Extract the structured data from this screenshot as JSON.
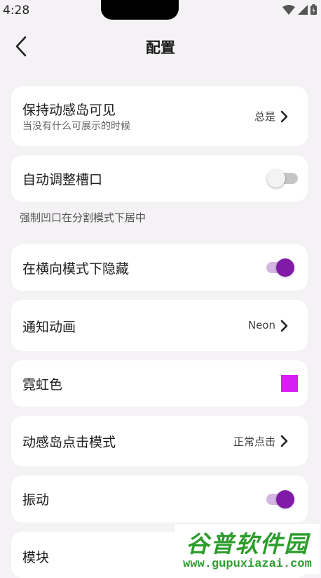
{
  "status_bar": {
    "time": "4:28"
  },
  "header": {
    "title": "配置"
  },
  "settings": {
    "keep_island": {
      "title": "保持动感岛可见",
      "subtitle": "当没有什么可展示的时候",
      "value": "总是"
    },
    "auto_adjust": {
      "title": "自动调整槽口",
      "enabled": false
    },
    "section_note": "强制凹口在分割模式下居中",
    "hide_landscape": {
      "title": "在横向模式下隐藏",
      "enabled": true
    },
    "notification_animation": {
      "title": "通知动画",
      "value": "Neon"
    },
    "neon_color": {
      "title": "霓虹色",
      "color": "#d61ef0"
    },
    "click_mode": {
      "title": "动感岛点击模式",
      "value": "正常点击"
    },
    "vibration": {
      "title": "振动",
      "enabled": true
    },
    "modules": {
      "title": "模块"
    }
  },
  "watermark": {
    "line1": "谷普软件园",
    "line2": "www.gupuxiazai.com"
  },
  "colors": {
    "accent": "#7f1ba7",
    "accent_track": "#d3b6e2",
    "background": "#f4f2f4"
  }
}
